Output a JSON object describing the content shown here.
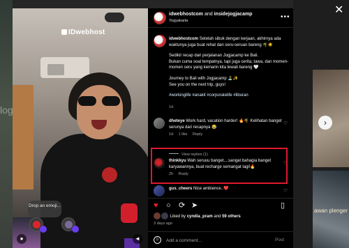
{
  "background": {
    "left_text": "log",
    "right_overlay_text": "awan plenger"
  },
  "media": {
    "watermark": "IDwebhost",
    "drop_bubble": "Drop an emoji...",
    "user_tag_icon": "person-icon",
    "audio_icon": "speaker-icon"
  },
  "post": {
    "header": {
      "user1": "idwebhostcom",
      "and": "and",
      "user2": "insidejogjacamp",
      "location": "Yogyakarta"
    },
    "caption": {
      "username": "idwebhostcom",
      "line1": "Setelah sibuk dengan kerjaan, akhirnya ada waktunya juga buat rehat dan seru-seruan bareng 🌴☀️",
      "line2": "Sedikit recap dari perjalanan Jogjacamp ke Bali.",
      "line3": "Bukan cuma soal tempatnya, tapi juga cerita, tawa, dan momen-momen seru yang kemarin kita lewati bareng 🤍",
      "line4": "Journey to Bali with Jogjacamp 🏝️✨",
      "line5": "See you on the next trip, guys!",
      "hashtags": "#workinglife #anakit #corporatelife #liburan",
      "time": "1d"
    },
    "comments": [
      {
        "username": "dheteye",
        "text": "Work hard, vacation harder! 🔥🌴 Kelihatan banget serunya dari recapnya 😂",
        "time": "1d",
        "likes": "1 like",
        "reply": "Reply",
        "view_replies": "View replies (1)"
      },
      {
        "username": "thinkkyu",
        "text": "Wah seruuu banget....sangat bahagia banget karyawannya, buat recharge semangat lagi!🔥",
        "time": "2h",
        "reply": "Reply"
      },
      {
        "username": "gus_cheers",
        "text": "Nice ambience..❤️"
      }
    ],
    "actions": {
      "like_icon": "heart-icon",
      "comment_icon": "comment-icon",
      "share_icon": "share-icon",
      "send_icon": "send-icon",
      "save_icon": "bookmark-icon"
    },
    "likes": {
      "prefix": "Liked by",
      "user": "cyndia_pram",
      "middle": "and",
      "others": "59 others"
    },
    "date": "3 days ago",
    "add_comment": {
      "placeholder": "Add a comment…",
      "post_label": "Post"
    }
  },
  "colors": {
    "panel_bg": "#000000",
    "highlight": "#e0182d",
    "like_red": "#ed1c24",
    "muted": "#a8a8a8"
  }
}
